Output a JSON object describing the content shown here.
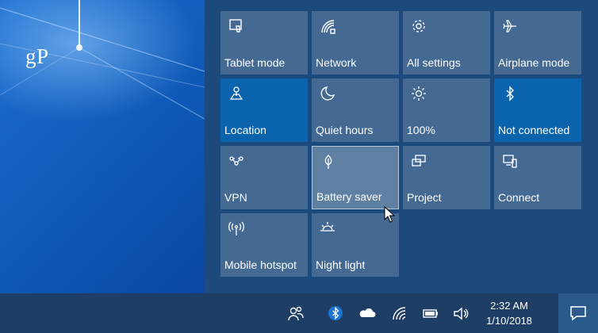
{
  "watermark": "gP",
  "action_center": {
    "tiles": [
      {
        "label": "Tablet mode",
        "icon": "tablet-mode-icon",
        "state": "off"
      },
      {
        "label": "Network",
        "icon": "network-icon",
        "state": "off"
      },
      {
        "label": "All settings",
        "icon": "gear-icon",
        "state": "off"
      },
      {
        "label": "Airplane mode",
        "icon": "airplane-icon",
        "state": "off"
      },
      {
        "label": "Location",
        "icon": "location-icon",
        "state": "on"
      },
      {
        "label": "Quiet hours",
        "icon": "moon-icon",
        "state": "off"
      },
      {
        "label": "100%",
        "icon": "brightness-icon",
        "state": "off"
      },
      {
        "label": "Not connected",
        "icon": "bluetooth-icon",
        "state": "on"
      },
      {
        "label": "VPN",
        "icon": "vpn-icon",
        "state": "off"
      },
      {
        "label": "Battery saver",
        "icon": "leaf-icon",
        "state": "hover"
      },
      {
        "label": "Project",
        "icon": "project-icon",
        "state": "off"
      },
      {
        "label": "Connect",
        "icon": "connect-icon",
        "state": "off"
      },
      {
        "label": "Mobile hotspot",
        "icon": "hotspot-icon",
        "state": "off"
      },
      {
        "label": "Night light",
        "icon": "night-light-icon",
        "state": "off"
      }
    ]
  },
  "taskbar": {
    "tray_icons": [
      "people-icon",
      "bluetooth-icon",
      "onedrive-icon",
      "wifi-icon",
      "battery-icon",
      "volume-icon"
    ],
    "time": "2:32 AM",
    "date": "1/10/2018",
    "notification_icon": "notification-icon"
  },
  "colors": {
    "panel_bg": "#1c4a7c",
    "tile_on": "#0a64ad",
    "taskbar_bg": "#1e3e66"
  }
}
